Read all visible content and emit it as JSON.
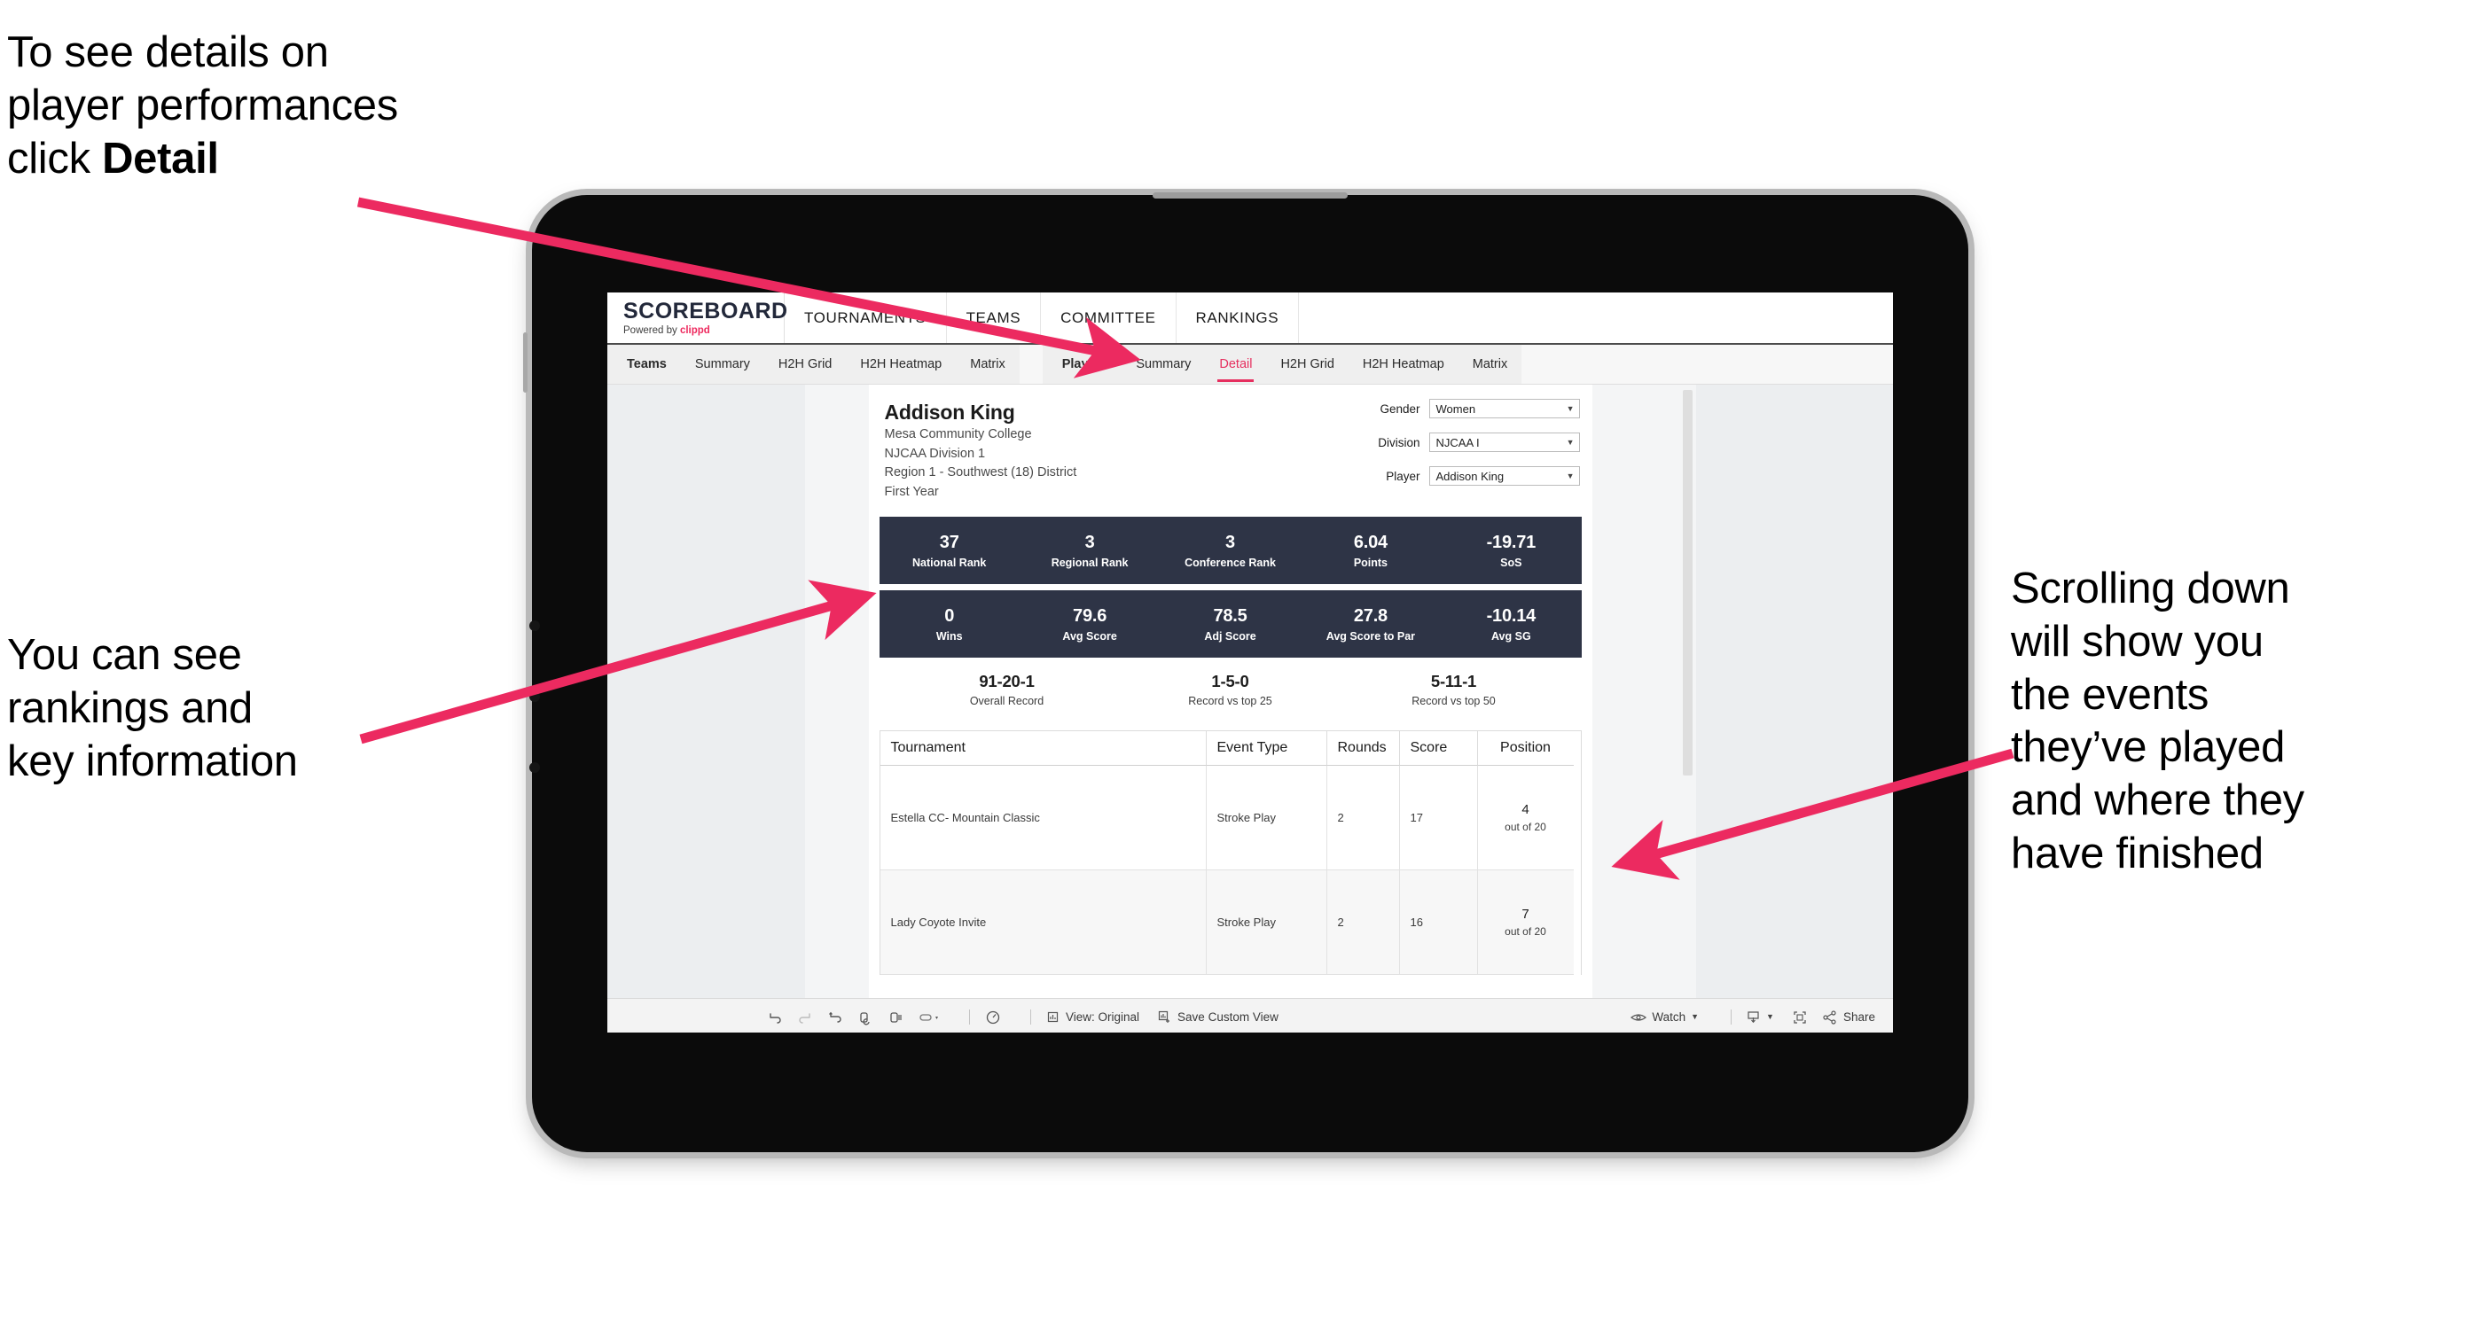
{
  "annotations": {
    "top_left": "To see details on\nplayer performances\nclick ",
    "top_left_bold": "Detail",
    "mid_left": "You can see\nrankings and\nkey information",
    "right": "Scrolling down\nwill show you\nthe events\nthey’ve played\nand where they\nhave finished"
  },
  "colors": {
    "accent_pink": "#ee2a5f",
    "band_navy": "#2e3446",
    "arrow_pink": "#ec2a60"
  },
  "app": {
    "brand": {
      "title": "SCOREBOARD",
      "powered_prefix": "Powered by ",
      "powered_name": "clippd"
    },
    "top_nav": [
      "TOURNAMENTS",
      "TEAMS",
      "COMMITTEE",
      "RANKINGS"
    ],
    "tabs_group_1": [
      "Teams",
      "Summary",
      "H2H Grid",
      "H2H Heatmap",
      "Matrix"
    ],
    "tabs_group_2": [
      "Players",
      "Summary",
      "Detail",
      "H2H Grid",
      "H2H Heatmap",
      "Matrix"
    ],
    "active_tab": "Detail"
  },
  "player": {
    "name": "Addison King",
    "school": "Mesa Community College",
    "division": "NJCAA Division 1",
    "region": "Region 1 - Southwest (18) District",
    "year": "First Year"
  },
  "filters": [
    {
      "label": "Gender",
      "value": "Women"
    },
    {
      "label": "Division",
      "value": "NJCAA I"
    },
    {
      "label": "Player",
      "value": "Addison King"
    }
  ],
  "stat_band_1": [
    {
      "value": "37",
      "label": "National Rank"
    },
    {
      "value": "3",
      "label": "Regional Rank"
    },
    {
      "value": "3",
      "label": "Conference Rank"
    },
    {
      "value": "6.04",
      "label": "Points"
    },
    {
      "value": "-19.71",
      "label": "SoS"
    }
  ],
  "stat_band_2": [
    {
      "value": "0",
      "label": "Wins"
    },
    {
      "value": "79.6",
      "label": "Avg Score"
    },
    {
      "value": "78.5",
      "label": "Adj Score"
    },
    {
      "value": "27.8",
      "label": "Avg Score to Par"
    },
    {
      "value": "-10.14",
      "label": "Avg SG"
    }
  ],
  "records": [
    {
      "value": "91-20-1",
      "label": "Overall Record"
    },
    {
      "value": "1-5-0",
      "label": "Record vs top 25"
    },
    {
      "value": "5-11-1",
      "label": "Record vs top 50"
    }
  ],
  "table": {
    "headers": [
      "Tournament",
      "Event Type",
      "Rounds",
      "Score",
      "Position"
    ],
    "rows": [
      {
        "tournament": "Estella CC- Mountain Classic",
        "event_type": "Stroke Play",
        "rounds": "2",
        "score": "17",
        "position": "4",
        "position_sub": "out of 20"
      },
      {
        "tournament": "Lady Coyote Invite",
        "event_type": "Stroke Play",
        "rounds": "2",
        "score": "16",
        "position": "7",
        "position_sub": "out of 20"
      }
    ]
  },
  "toolbar": {
    "view_label": "View: Original",
    "save_label": "Save Custom View",
    "watch_label": "Watch",
    "share_label": "Share"
  }
}
